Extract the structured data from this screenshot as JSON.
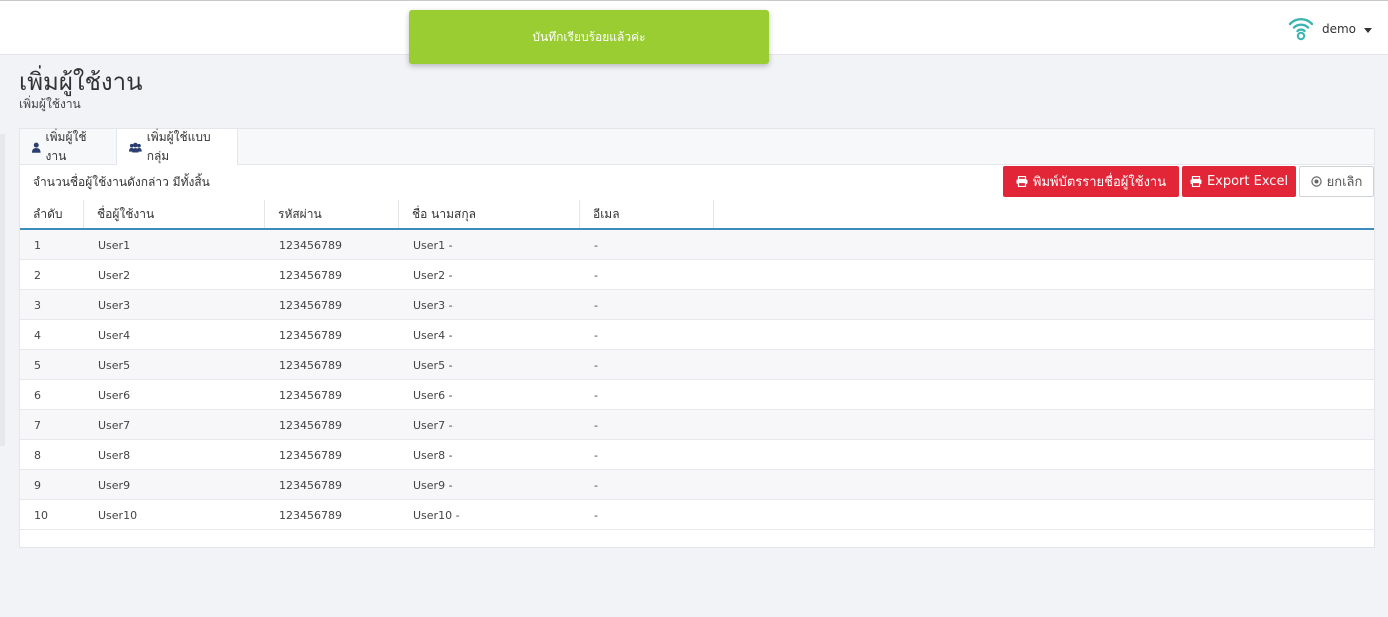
{
  "toast": {
    "message": "บันทึกเรียบร้อยแล้วค่ะ"
  },
  "header": {
    "user_name": "demo",
    "logo_icon": "wifi-signal-icon"
  },
  "page": {
    "title": "เพิ่มผู้ใช้งาน",
    "subtitle": "เพิ่มผู้ใช้งาน"
  },
  "tabs": [
    {
      "label": "เพิ่มผู้ใช้งาน",
      "icon": "user-icon"
    },
    {
      "label": "เพิ่มผู้ใช้แบบกลุ่ม",
      "icon": "users-group-icon",
      "active": true
    }
  ],
  "summary": {
    "text": "จำนวนชื่อผู้ใช้งานดังกล่าว มีทั้งสิ้น"
  },
  "buttons": {
    "print": "พิมพ์บัตรรายชื่อผู้ใช้งาน",
    "export": "Export Excel",
    "cancel": "ยกเลิก"
  },
  "colors": {
    "toast": "#9acd32",
    "danger": "#e32637",
    "accent_line": "#3c8dbc"
  },
  "table": {
    "headers": [
      "ลำดับ",
      "ชื่อผู้ใช้งาน",
      "รหัสผ่าน",
      "ชื่อ นามสกุล",
      "อีเมล"
    ],
    "rows": [
      [
        "1",
        "User1",
        "123456789",
        "User1 -",
        "-"
      ],
      [
        "2",
        "User2",
        "123456789",
        "User2 -",
        "-"
      ],
      [
        "3",
        "User3",
        "123456789",
        "User3 -",
        "-"
      ],
      [
        "4",
        "User4",
        "123456789",
        "User4 -",
        "-"
      ],
      [
        "5",
        "User5",
        "123456789",
        "User5 -",
        "-"
      ],
      [
        "6",
        "User6",
        "123456789",
        "User6 -",
        "-"
      ],
      [
        "7",
        "User7",
        "123456789",
        "User7 -",
        "-"
      ],
      [
        "8",
        "User8",
        "123456789",
        "User8 -",
        "-"
      ],
      [
        "9",
        "User9",
        "123456789",
        "User9 -",
        "-"
      ],
      [
        "10",
        "User10",
        "123456789",
        "User10 -",
        "-"
      ]
    ]
  }
}
